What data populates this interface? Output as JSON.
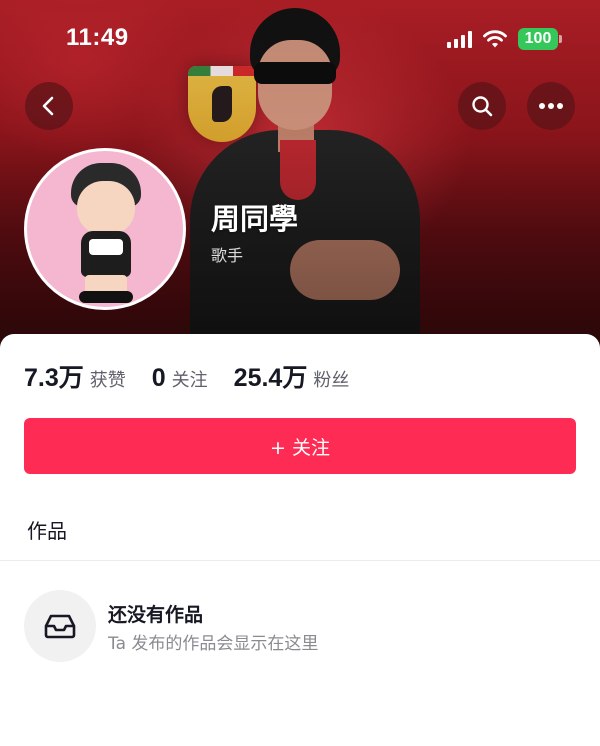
{
  "status_bar": {
    "time": "11:49",
    "battery": "100",
    "battery_color": "#35c759",
    "icons": [
      "signal-icon",
      "wifi-icon",
      "battery-icon"
    ]
  },
  "header": {
    "buttons": [
      "back-icon",
      "search-icon",
      "more-icon"
    ],
    "cover_colors": [
      "#b21f27",
      "#3a0a0c"
    ]
  },
  "profile": {
    "name": "周同學",
    "role": "歌手"
  },
  "stats": [
    {
      "value": "7.3万",
      "label": "获赞"
    },
    {
      "value": "0",
      "label": "关注"
    },
    {
      "value": "25.4万",
      "label": "粉丝"
    }
  ],
  "follow_button": {
    "label": "+ 关注",
    "color": "#fe2c55"
  },
  "works": {
    "section_title": "作品",
    "empty_title": "还没有作品",
    "empty_subtitle": "Ta 发布的作品会显示在这里",
    "empty_icon": "inbox-icon"
  }
}
